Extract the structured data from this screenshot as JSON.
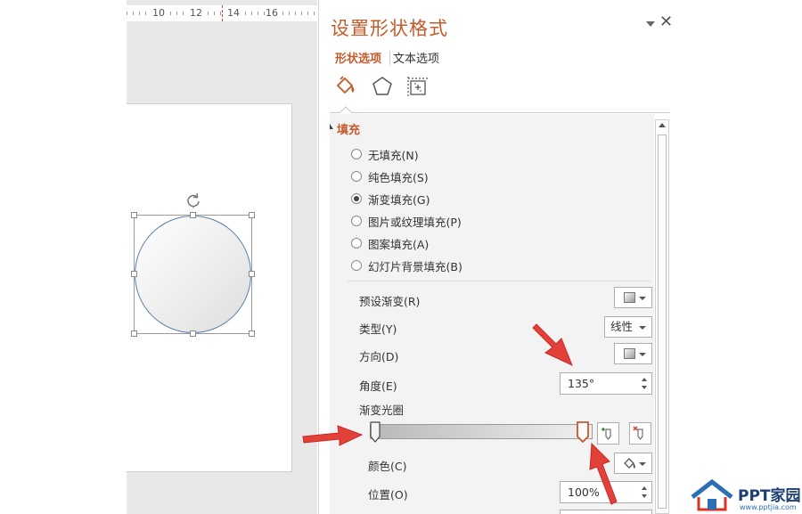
{
  "ruler": {
    "marks": [
      "10",
      "12",
      "14",
      "16"
    ]
  },
  "panel": {
    "title": "设置形状格式",
    "tabs": {
      "shape": "形状选项",
      "text": "文本选项"
    },
    "close_glyph": "✕"
  },
  "fill": {
    "header": "填充",
    "options": [
      {
        "label": "无填充(N)",
        "checked": false
      },
      {
        "label": "纯色填充(S)",
        "checked": false
      },
      {
        "label": "渐变填充(G)",
        "checked": true
      },
      {
        "label": "图片或纹理填充(P)",
        "checked": false
      },
      {
        "label": "图案填充(A)",
        "checked": false
      },
      {
        "label": "幻灯片背景填充(B)",
        "checked": false
      }
    ]
  },
  "gradient": {
    "preset_label": "预设渐变(R)",
    "type_label": "类型(Y)",
    "type_value": "线性",
    "direction_label": "方向(D)",
    "angle_label": "角度(E)",
    "angle_value": "135°",
    "stops_label": "渐变光圈",
    "color_label": "颜色(C)",
    "position_label": "位置(O)",
    "position_value": "100%"
  },
  "colors": {
    "accent": "#c55a2b",
    "arrow": "#e5403a"
  },
  "watermark": {
    "name": "PPT家园",
    "url": "www.pptjia.com"
  }
}
